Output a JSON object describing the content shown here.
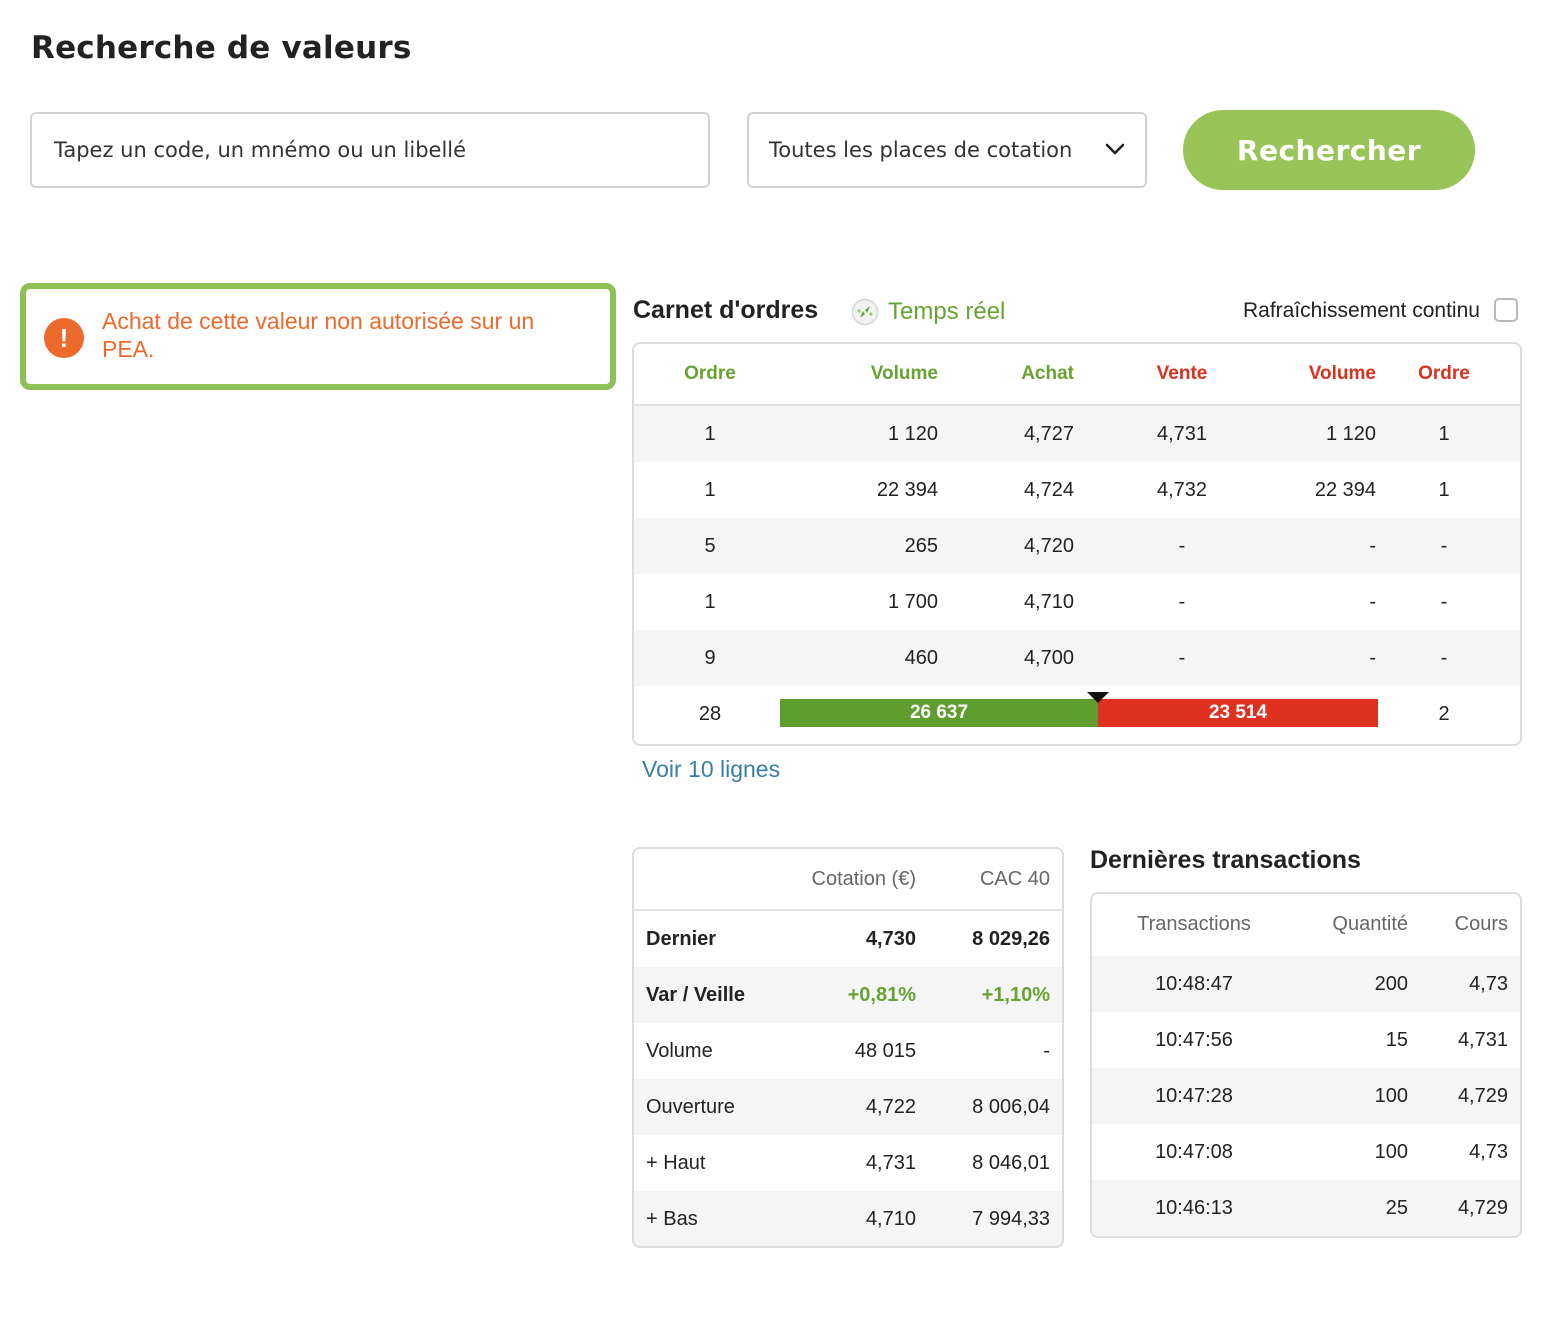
{
  "page": {
    "title": "Recherche de valeurs"
  },
  "search": {
    "placeholder": "Tapez un code, un mnémo ou un libellé",
    "place_selected": "Toutes les places de cotation",
    "button_label": "Rechercher"
  },
  "warning": {
    "text": "Achat de cette valeur non autorisée sur un PEA.",
    "icon": "exclamation-circle-icon"
  },
  "order_book": {
    "title": "Carnet d'ordres",
    "realtime_label": "Temps réel",
    "refresh_label": "Rafraîchissement continu",
    "refresh_checked": false,
    "headers": {
      "bid_orders": "Ordre",
      "bid_volume": "Volume",
      "bid_price": "Achat",
      "ask_price": "Vente",
      "ask_volume": "Volume",
      "ask_orders": "Ordre"
    },
    "rows": [
      {
        "bid_orders": "1",
        "bid_volume": "1 120",
        "bid_price": "4,727",
        "ask_price": "4,731",
        "ask_volume": "1 120",
        "ask_orders": "1"
      },
      {
        "bid_orders": "1",
        "bid_volume": "22 394",
        "bid_price": "4,724",
        "ask_price": "4,732",
        "ask_volume": "22 394",
        "ask_orders": "1"
      },
      {
        "bid_orders": "5",
        "bid_volume": "265",
        "bid_price": "4,720",
        "ask_price": "-",
        "ask_volume": "-",
        "ask_orders": "-"
      },
      {
        "bid_orders": "1",
        "bid_volume": "1 700",
        "bid_price": "4,710",
        "ask_price": "-",
        "ask_volume": "-",
        "ask_orders": "-"
      },
      {
        "bid_orders": "9",
        "bid_volume": "460",
        "bid_price": "4,700",
        "ask_price": "-",
        "ask_volume": "-",
        "ask_orders": "-"
      }
    ],
    "totals": {
      "bid_orders": "28",
      "bid_volume": "26 637",
      "ask_volume": "23 514",
      "ask_orders": "2"
    },
    "see_more_link": "Voir 10 lignes",
    "colors": {
      "bid": "#67a332",
      "ask": "#d8321f",
      "bid_bar": "#5f9e2e",
      "ask_bar": "#df3120"
    }
  },
  "quote": {
    "headers": {
      "col1": "Cotation (€)",
      "col2": "CAC 40"
    },
    "rows": [
      {
        "label": "Dernier",
        "value": "4,730",
        "index": "8 029,26"
      },
      {
        "label": "Var / Veille",
        "value": "+0,81%",
        "index": "+1,10%"
      },
      {
        "label": "Volume",
        "value": "48 015",
        "index": "-"
      },
      {
        "label": "Ouverture",
        "value": "4,722",
        "index": "8 006,04"
      },
      {
        "label": "+ Haut",
        "value": "4,731",
        "index": "8 046,01"
      },
      {
        "label": "+ Bas",
        "value": "4,710",
        "index": "7 994,33"
      }
    ]
  },
  "transactions": {
    "title": "Dernières transactions",
    "headers": {
      "time": "Transactions",
      "quantity": "Quantité",
      "price": "Cours"
    },
    "rows": [
      {
        "time": "10:48:47",
        "quantity": "200",
        "price": "4,73"
      },
      {
        "time": "10:47:56",
        "quantity": "15",
        "price": "4,731"
      },
      {
        "time": "10:47:28",
        "quantity": "100",
        "price": "4,729"
      },
      {
        "time": "10:47:08",
        "quantity": "100",
        "price": "4,73"
      },
      {
        "time": "10:46:13",
        "quantity": "25",
        "price": "4,729"
      }
    ]
  }
}
